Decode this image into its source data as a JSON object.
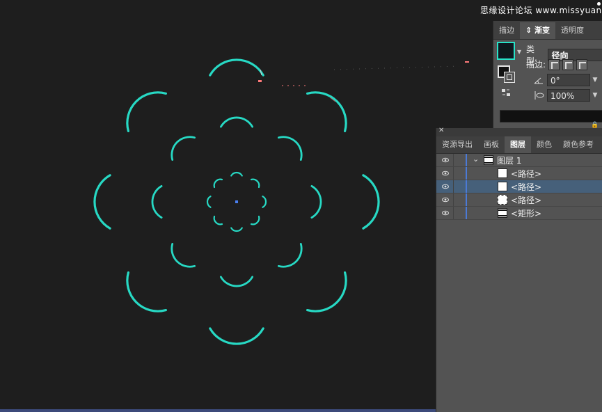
{
  "watermark": "思缘设计论坛 www.missyuan.com",
  "colors": {
    "canvas_bg": "#1e1e1e",
    "arc_color": "#27d9c4",
    "panel_bg": "#535353",
    "selected_row": "#46607a",
    "layer_bar": "#4b7ad6"
  },
  "gradient_panel": {
    "tabs": [
      {
        "label": "描边",
        "active": false
      },
      {
        "label": "⇕ 渐变",
        "active": true
      },
      {
        "label": "透明度",
        "active": false
      }
    ],
    "type_label": "类型:",
    "type_value": "径向",
    "stroke_label": "描边:",
    "angle_value": "0°",
    "aspect_value": "100%"
  },
  "layers_panel": {
    "tabs": [
      {
        "label": "资源导出",
        "active": false
      },
      {
        "label": "画板",
        "active": false
      },
      {
        "label": "图层",
        "active": true
      },
      {
        "label": "颜色",
        "active": false
      },
      {
        "label": "颜色参考",
        "active": false
      }
    ],
    "layers": [
      {
        "name": "图层 1",
        "kind": "layer",
        "selected": false
      },
      {
        "name": "<路径>",
        "kind": "path",
        "selected": false
      },
      {
        "name": "<路径>",
        "kind": "path",
        "selected": true
      },
      {
        "name": "<路径>",
        "kind": "path-dashed",
        "selected": false
      },
      {
        "name": "<矩形>",
        "kind": "rect",
        "selected": false
      }
    ]
  }
}
